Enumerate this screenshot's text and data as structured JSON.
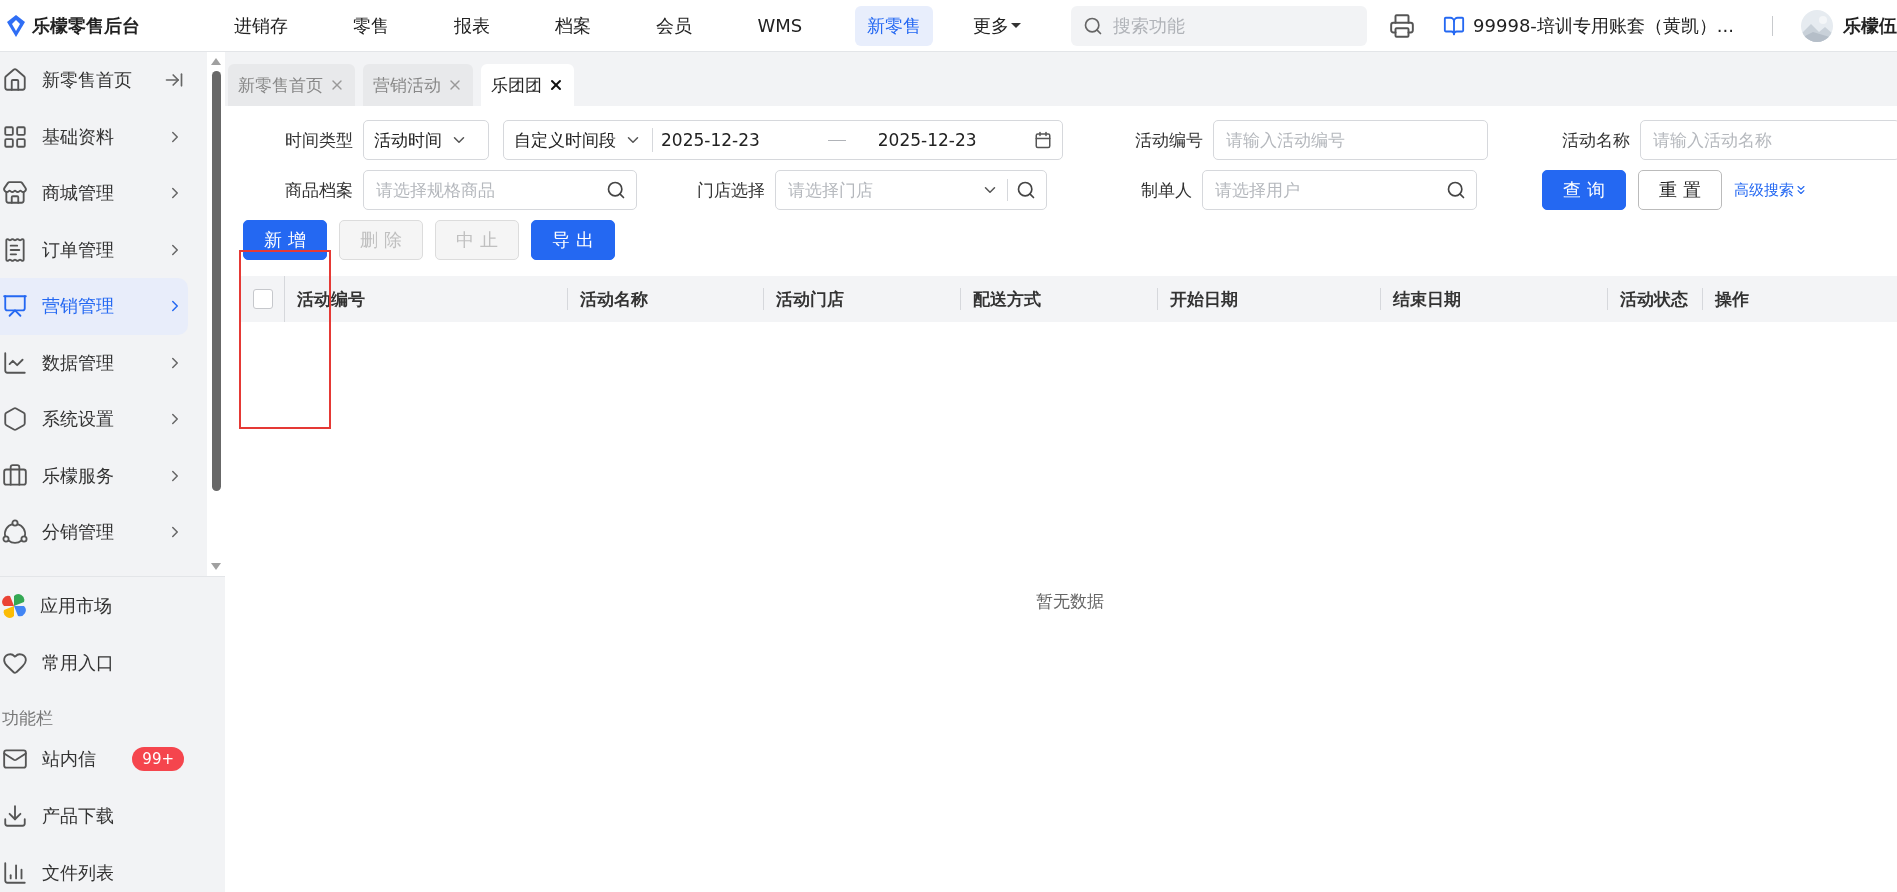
{
  "brand": {
    "name": "乐檬零售后台"
  },
  "top_nav": [
    {
      "label": "进销存",
      "selected": false
    },
    {
      "label": "零售",
      "selected": false
    },
    {
      "label": "报表",
      "selected": false
    },
    {
      "label": "档案",
      "selected": false
    },
    {
      "label": "会员",
      "selected": false
    },
    {
      "label": "WMS",
      "selected": false
    },
    {
      "label": "新零售",
      "selected": true
    }
  ],
  "more_menu": {
    "label": "更多"
  },
  "search": {
    "placeholder": "搜索功能"
  },
  "account": {
    "label": "99998-培训专用账套（黄凯）..."
  },
  "user": {
    "name": "乐檬伍"
  },
  "sidebar": {
    "items": [
      {
        "label": "新零售首页",
        "selected": false
      },
      {
        "label": "基础资料",
        "selected": false
      },
      {
        "label": "商城管理",
        "selected": false
      },
      {
        "label": "订单管理",
        "selected": false
      },
      {
        "label": "营销管理",
        "selected": true
      },
      {
        "label": "数据管理",
        "selected": false
      },
      {
        "label": "系统设置",
        "selected": false
      },
      {
        "label": "乐檬服务",
        "selected": false
      },
      {
        "label": "分销管理",
        "selected": false
      }
    ],
    "pinned": [
      {
        "label": "应用市场"
      },
      {
        "label": "常用入口"
      }
    ],
    "section_title": "功能栏",
    "tools": [
      {
        "label": "站内信",
        "badge": "99+"
      },
      {
        "label": "产品下载"
      },
      {
        "label": "文件列表"
      }
    ]
  },
  "tabs": [
    {
      "label": "新零售首页",
      "selected": false
    },
    {
      "label": "营销活动",
      "selected": false
    },
    {
      "label": "乐团团",
      "selected": true
    }
  ],
  "filters": {
    "time_type": {
      "label": "时间类型",
      "value": "活动时间"
    },
    "date_range": {
      "mode": "自定义时间段",
      "start": "2025-12-23",
      "end": "2025-12-23"
    },
    "activity_no": {
      "label": "活动编号",
      "placeholder": "请输入活动编号"
    },
    "activity_name": {
      "label": "活动名称",
      "placeholder": "请输入活动名称"
    },
    "product": {
      "label": "商品档案",
      "placeholder": "请选择规格商品"
    },
    "store": {
      "label": "门店选择",
      "placeholder": "请选择门店"
    },
    "creator": {
      "label": "制单人",
      "placeholder": "请选择用户"
    },
    "query_button": "查询",
    "reset_button": "重置",
    "advanced_link": "高级搜索"
  },
  "actions": [
    {
      "label": "新增",
      "disabled": false
    },
    {
      "label": "删除",
      "disabled": true
    },
    {
      "label": "中止",
      "disabled": true
    },
    {
      "label": "导出",
      "disabled": false
    }
  ],
  "table": {
    "select_all_checked": false,
    "columns": [
      "活动编号",
      "活动名称",
      "活动门店",
      "配送方式",
      "开始日期",
      "结束日期",
      "活动状态",
      "操作"
    ],
    "empty_text": "暂无数据"
  }
}
